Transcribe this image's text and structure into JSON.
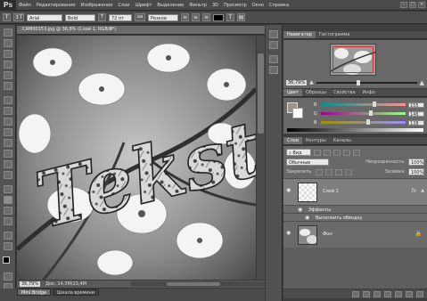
{
  "app": {
    "logo": "Ps",
    "menu": [
      "Файл",
      "Редактирование",
      "Изображение",
      "Слои",
      "Шрифт",
      "Выделение",
      "Фильтр",
      "3D",
      "Просмотр",
      "Окно",
      "Справка"
    ],
    "window_controls": [
      "–",
      "□",
      "×"
    ]
  },
  "options": {
    "tool_icon": "T",
    "orient_icon": "↕T",
    "font": "Arial",
    "style": "Bold",
    "size": "72 пт",
    "aa_icon": "aa",
    "aa_mode": "Резкое",
    "text_color": "#000000"
  },
  "document": {
    "tab_title": "CAM00153.jpg @ 36,8% (Слой 1, RGB/8*)",
    "close": "×",
    "zoom": "36,79%",
    "doc_info": "Док: 14,3М/23,4М",
    "canvas_text": "Tekst"
  },
  "bottom_tabs": [
    "Mini Bridge",
    "Шкала времени"
  ],
  "navigator": {
    "tabs": [
      "Навигатор",
      "Гистограмма"
    ],
    "zoom": "36,79%"
  },
  "color_panel": {
    "tabs": [
      "Цвет",
      "Образцы",
      "Свойства",
      "Инфо"
    ],
    "channels": [
      {
        "label": "R",
        "value": "155",
        "level": 0.61
      },
      {
        "label": "G",
        "value": "146",
        "level": 0.57
      },
      {
        "label": "B",
        "value": "138",
        "level": 0.54
      }
    ],
    "fg_color": "#9b928a"
  },
  "layers": {
    "tabs": [
      "Слои",
      "Контуры",
      "Каналы"
    ],
    "filter_label": "Вид",
    "blend_mode": "Обычные",
    "opacity_label": "Непрозрачность:",
    "opacity": "100%",
    "lock_label": "Закрепить:",
    "fill_label": "Заливка:",
    "fill": "100%",
    "items": [
      {
        "name": "Слой 1",
        "fx": "fx",
        "effects_label": "Эффекты",
        "effect_item": "Выполнить обводку"
      },
      {
        "name": "Фон"
      }
    ]
  }
}
